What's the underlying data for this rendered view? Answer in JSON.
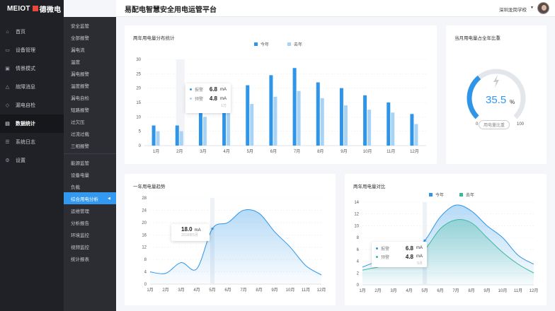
{
  "app": {
    "brand": "MEIOT",
    "brand_cn": "德微电",
    "title": "易配电智慧安全用电运管平台",
    "school": "深圳龙岗学校"
  },
  "nav_primary": [
    {
      "label": "首页",
      "icon": "home-icon",
      "active": false
    },
    {
      "label": "设备管理",
      "icon": "device-icon",
      "active": false
    },
    {
      "label": "情景模式",
      "icon": "scene-icon",
      "active": false
    },
    {
      "label": "故障消息",
      "icon": "alert-icon",
      "active": false
    },
    {
      "label": "漏电自检",
      "icon": "check-icon",
      "active": false
    },
    {
      "label": "数据统计",
      "icon": "chart-icon",
      "active": true
    },
    {
      "label": "系统日志",
      "icon": "log-icon",
      "active": false
    },
    {
      "label": "设置",
      "icon": "gear-icon",
      "active": false
    }
  ],
  "nav_secondary": {
    "group1": [
      "安全监管",
      "全部报警",
      "漏电流",
      "温度",
      "漏电报警",
      "温度报警",
      "漏电自检",
      "短路报警",
      "过欠压",
      "过流过载",
      "三相报警"
    ],
    "group2": [
      "能源监管",
      "设备电量",
      "负载",
      "综合用电分析",
      "运维管理",
      "分析报告",
      "环境监控",
      "视频监控",
      "统计报表"
    ],
    "active": "综合用电分析"
  },
  "colors": {
    "this_year": "#2e95e8",
    "last_year": "#a9d3f5",
    "compare_last": "#3bb89a"
  },
  "card_bar": {
    "title": "两年用电量分布统计",
    "legend": [
      "今年",
      "去年"
    ],
    "tooltip": {
      "label1": "报警",
      "value1": "6.8",
      "label2": "预警",
      "value2": "4.8",
      "unit": "mA",
      "month": "1万"
    }
  },
  "card_gauge": {
    "title": "当月用电量占全年比重",
    "value": "35.5",
    "unit": "%",
    "min": "0",
    "max": "100",
    "label": "用电量比重",
    "icon": "bolt-icon"
  },
  "card_line1": {
    "title": "一年用电量趋势",
    "tooltip": {
      "value": "18.0",
      "unit": "mA",
      "date": "2018年5月"
    }
  },
  "card_line2": {
    "title": "两年用电量对比",
    "legend": [
      "今年",
      "去年"
    ],
    "tooltip": {
      "label1": "报警",
      "value1": "6.8",
      "label2": "预警",
      "value2": "4.8",
      "unit": "mA",
      "month": "5月"
    }
  },
  "chart_data": [
    {
      "type": "bar",
      "title": "两年用电量分布统计",
      "categories": [
        "1月",
        "2月",
        "3月",
        "4月",
        "5月",
        "6月",
        "7月",
        "8月",
        "9月",
        "10月",
        "11月",
        "12月"
      ],
      "series": [
        {
          "name": "今年",
          "values": [
            7,
            7,
            13,
            18,
            21,
            24.5,
            27,
            22,
            20,
            17.5,
            15,
            11
          ]
        },
        {
          "name": "去年",
          "values": [
            5,
            5,
            10,
            16,
            14.5,
            17,
            19,
            16.5,
            14,
            12.5,
            11.5,
            7.5
          ]
        }
      ],
      "yticks": [
        0,
        5,
        10,
        15,
        20,
        25,
        30
      ],
      "ylim": [
        0,
        30
      ]
    },
    {
      "type": "area",
      "title": "一年用电量趋势",
      "categories": [
        "1月",
        "2月",
        "3月",
        "4月",
        "5月",
        "6月",
        "7月",
        "8月",
        "9月",
        "10月",
        "11月",
        "12月"
      ],
      "series": [
        {
          "values": [
            4,
            3.5,
            7,
            5,
            18,
            20,
            24,
            23,
            17,
            12,
            6,
            3
          ]
        }
      ],
      "yticks": [
        0,
        4,
        8,
        12,
        16,
        20,
        24,
        28
      ],
      "ylim": [
        0,
        28
      ]
    },
    {
      "type": "area",
      "title": "两年用电量对比",
      "categories": [
        "1月",
        "2月",
        "3月",
        "4月",
        "5月",
        "6月",
        "7月",
        "8月",
        "9月",
        "10月",
        "11月",
        "12月"
      ],
      "series": [
        {
          "name": "今年",
          "values": [
            3,
            4,
            4.5,
            5.5,
            7.5,
            11.5,
            13.5,
            12.5,
            10,
            8,
            5,
            3.5
          ]
        },
        {
          "name": "去年",
          "values": [
            2.5,
            3,
            3.5,
            4.5,
            6,
            9.5,
            11,
            10.5,
            8,
            5.5,
            3.5,
            2
          ]
        }
      ],
      "yticks": [
        0,
        2,
        4,
        6,
        8,
        10,
        12,
        14
      ],
      "ylim": [
        0,
        14
      ]
    }
  ]
}
